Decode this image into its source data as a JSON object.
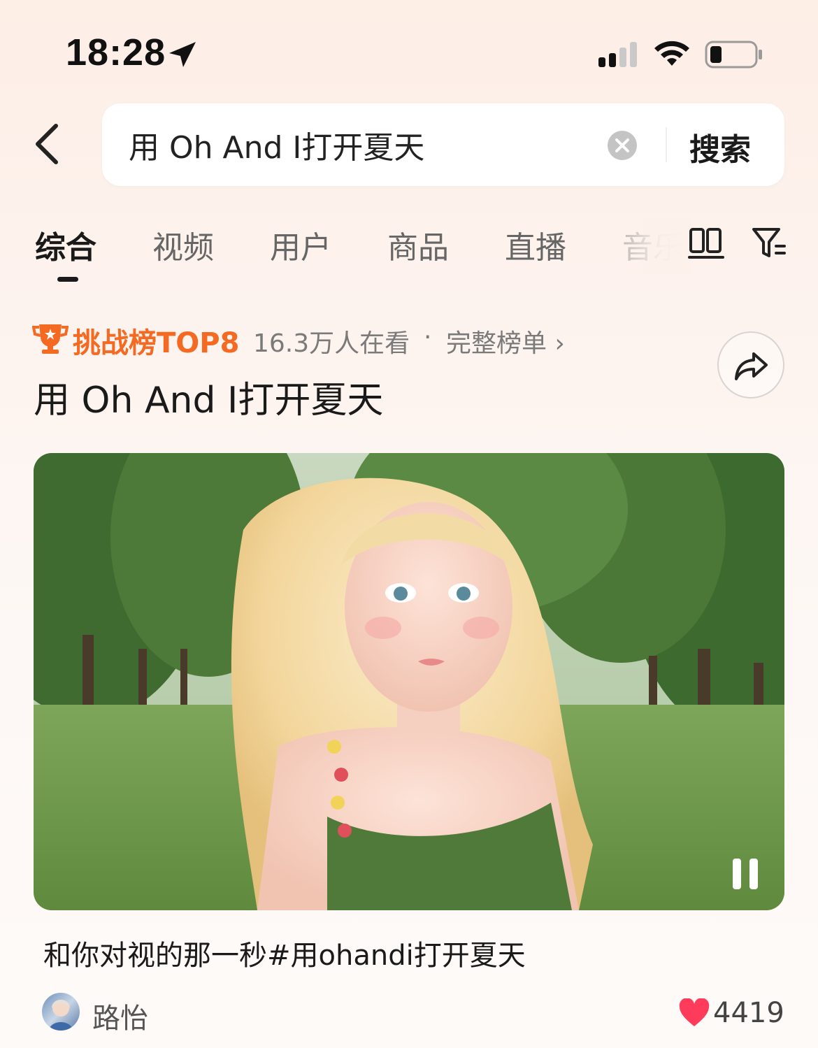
{
  "status_bar": {
    "time": "18:28",
    "icons": [
      "location-arrow-icon",
      "cellular-signal-icon",
      "wifi-icon",
      "battery-icon"
    ]
  },
  "search": {
    "query": "用 Oh And I打开夏天",
    "button_label": "搜索"
  },
  "tabs": [
    {
      "label": "综合",
      "active": true
    },
    {
      "label": "视频",
      "active": false
    },
    {
      "label": "用户",
      "active": false
    },
    {
      "label": "商品",
      "active": false
    },
    {
      "label": "直播",
      "active": false
    },
    {
      "label": "音乐",
      "active": false
    }
  ],
  "challenge": {
    "badge": "挑战榜TOP8",
    "viewers": "16.3万人在看",
    "separator": "·",
    "full_list_label": "完整榜单 ›",
    "title": "用 Oh And I打开夏天"
  },
  "video": {
    "caption": "和你对视的那一秒#用ohandi打开夏天",
    "author": "路怡",
    "likes": "4419"
  },
  "colors": {
    "accent_orange": "#f46a22",
    "like_red": "#ff3b5c",
    "text_primary": "#1a1a1a",
    "text_secondary": "#7a7a7a"
  }
}
